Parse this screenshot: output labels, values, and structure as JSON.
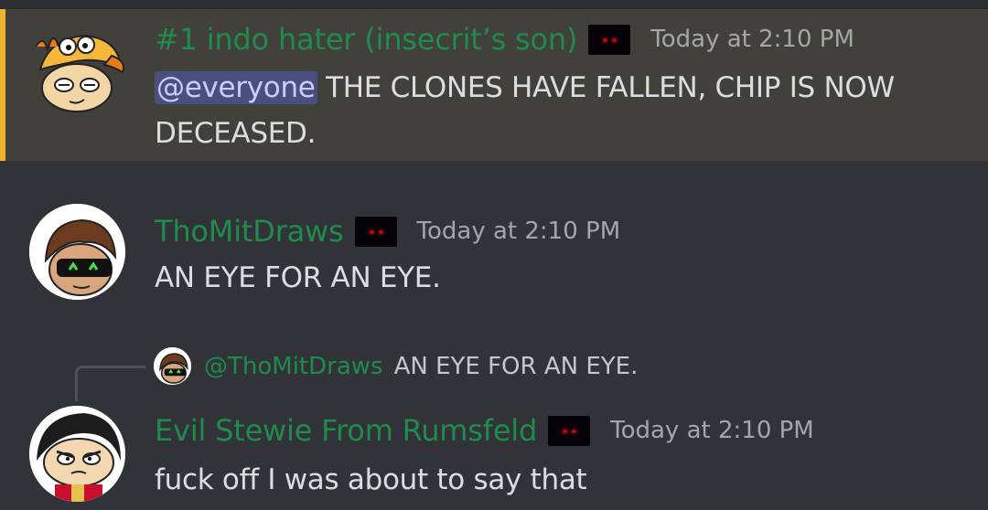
{
  "messages": [
    {
      "username": "#1 indo hater (insecrit’s son)",
      "timestamp": "Today at 2:10 PM",
      "mention": "@everyone",
      "line1": "THE CLONES HAVE FALLEN, CHIP IS NOW",
      "line2": "DECEASED."
    },
    {
      "username": "ThoMitDraws",
      "timestamp": "Today at 2:10 PM",
      "text": "AN EYE FOR AN EYE."
    },
    {
      "reply_to": {
        "username": "@ThoMitDraws",
        "text": "AN EYE FOR AN EYE."
      },
      "username": "Evil Stewie From Rumsfeld",
      "timestamp": "Today at 2:10 PM",
      "text": "fuck off I was about to say that"
    }
  ],
  "colors": {
    "background": "#313338",
    "highlight_background": "#41403a",
    "highlight_bar": "#f0b232",
    "username": "#1f8b4c",
    "timestamp": "#a3a6aa",
    "text": "#dbdee1",
    "mention_bg": "#4a4f7f"
  }
}
